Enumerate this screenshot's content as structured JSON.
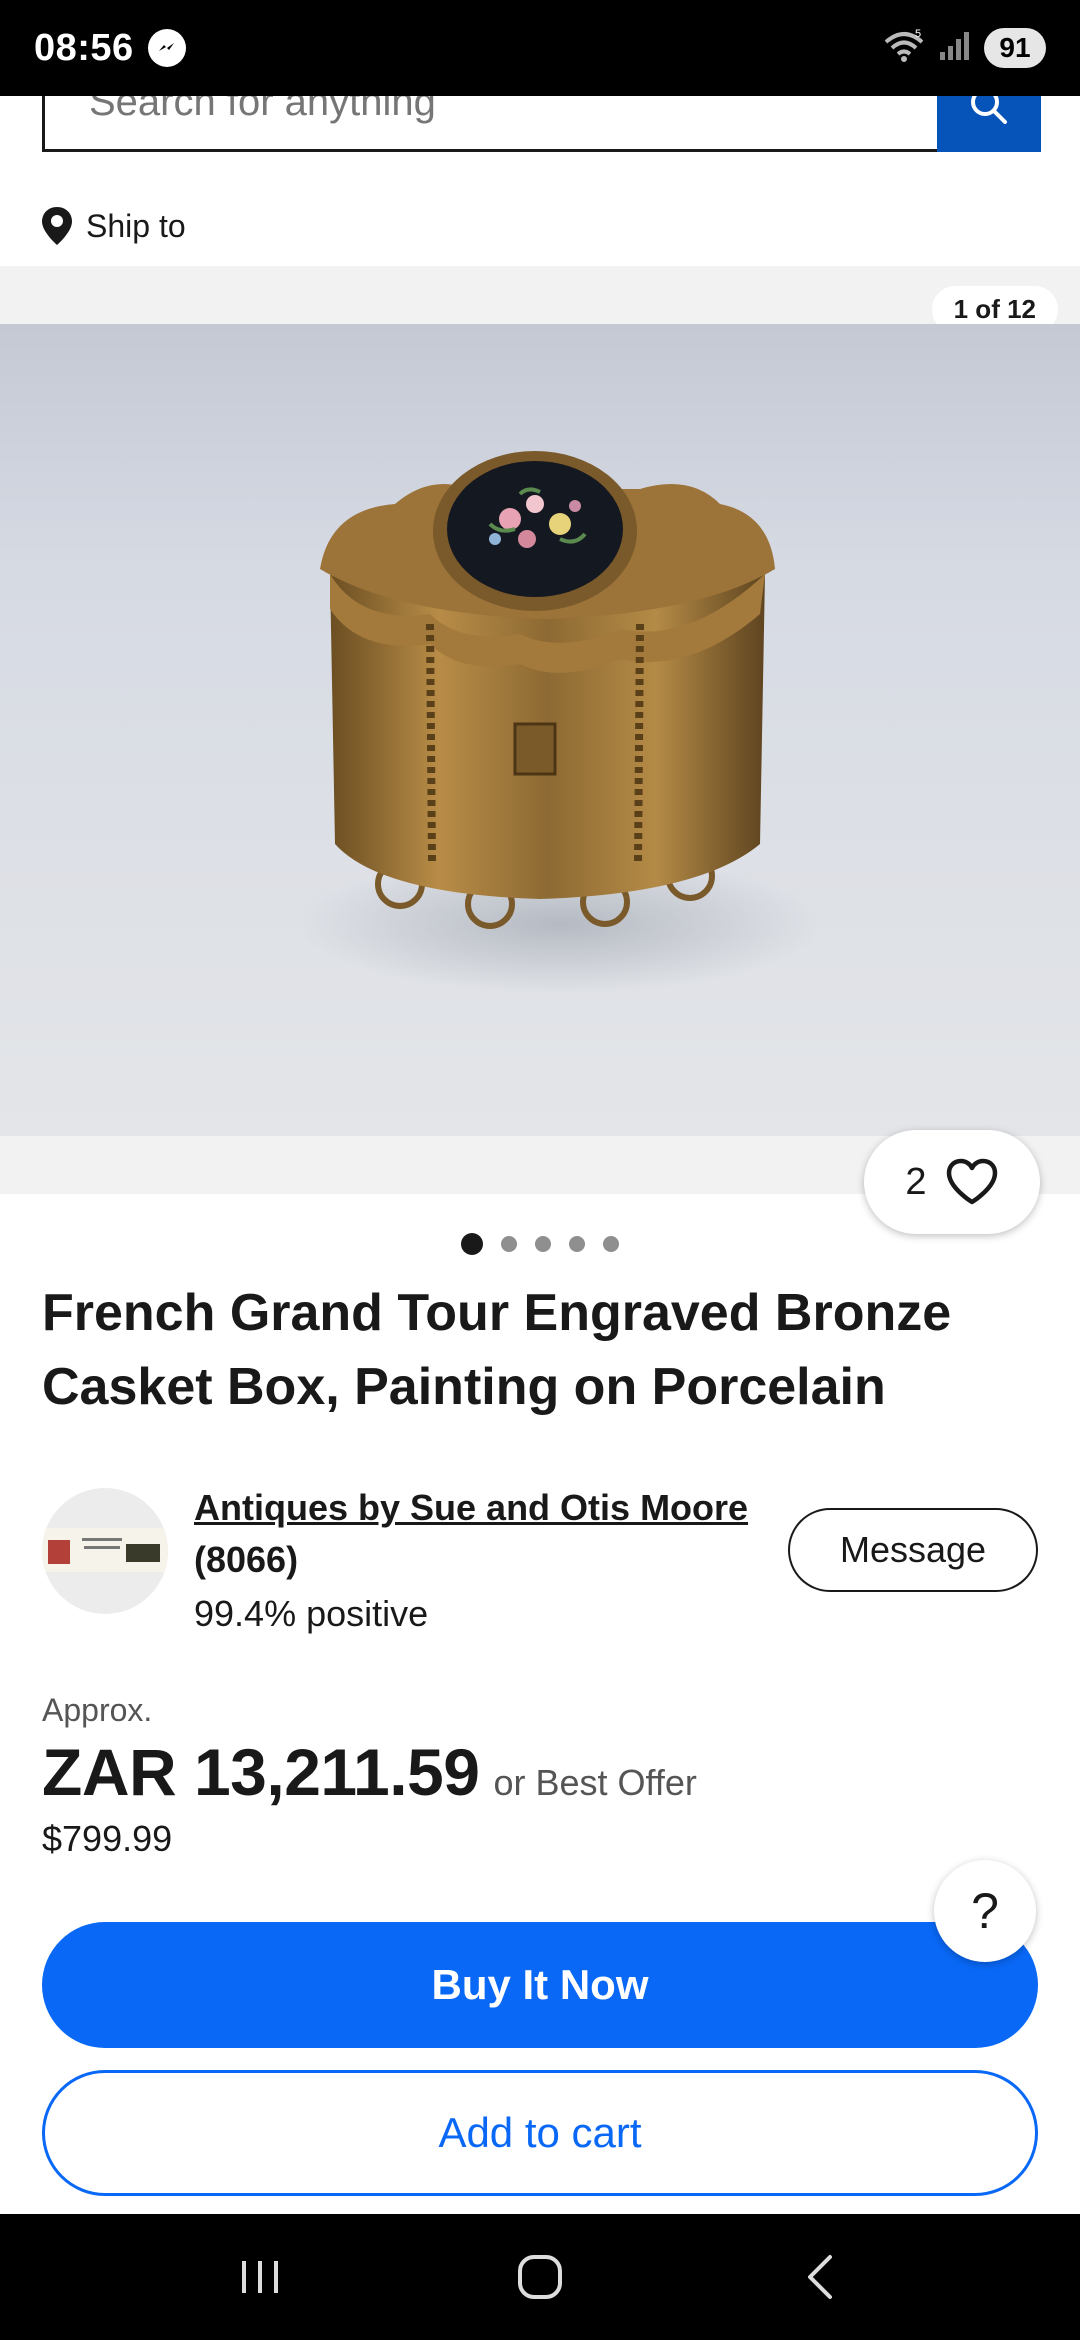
{
  "status_bar": {
    "time": "08:56",
    "battery": "91",
    "icons": [
      "messenger-icon",
      "wifi-icon",
      "signal-icon"
    ]
  },
  "search": {
    "placeholder": "Search for anything"
  },
  "ship_to": {
    "label": "Ship to"
  },
  "gallery": {
    "counter": "1 of 12",
    "watch_count": "2",
    "dots_total": 5,
    "dots_active": 1
  },
  "listing": {
    "title": "French Grand Tour Engraved Bronze Casket Box, Painting on Porcelain"
  },
  "seller": {
    "name": "Antiques by Sue and Otis Moore",
    "feedback_count": "(8066)",
    "positive": "99.4% positive",
    "message_label": "Message"
  },
  "price": {
    "approx_label": "Approx.",
    "main": "ZAR 13,211.59",
    "offer": "or Best Offer",
    "usd": "$799.99"
  },
  "help": {
    "label": "?"
  },
  "actions": {
    "buy_now": "Buy It Now",
    "add_to_cart": "Add to cart"
  },
  "colors": {
    "accent_blue": "#0968f6",
    "search_blue": "#0654ba",
    "text": "#191919"
  }
}
